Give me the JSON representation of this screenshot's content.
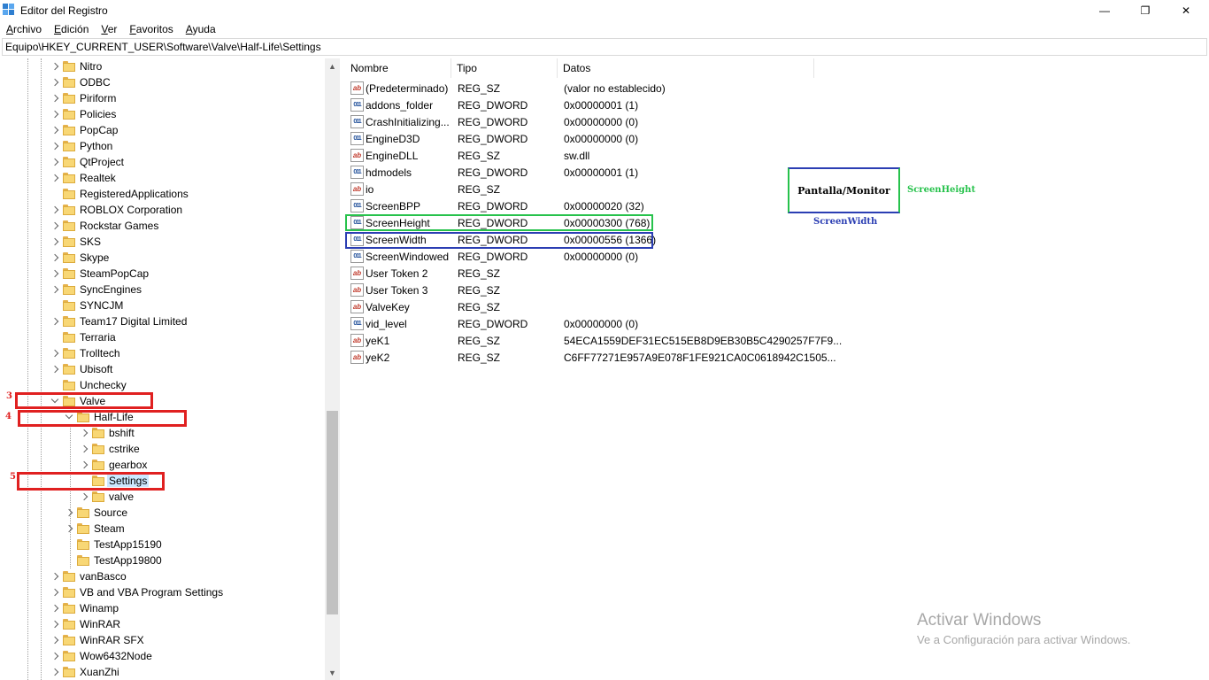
{
  "window": {
    "title": "Editor del Registro",
    "min_glyph": "—",
    "max_glyph": "❐",
    "close_glyph": "✕"
  },
  "menu": [
    {
      "u": "A",
      "rest": "rchivo"
    },
    {
      "u": "E",
      "rest": "dición"
    },
    {
      "u": "V",
      "rest": "er"
    },
    {
      "u": "F",
      "rest": "avoritos"
    },
    {
      "u": "A",
      "rest": "yuda"
    }
  ],
  "address": "Equipo\\HKEY_CURRENT_USER\\Software\\Valve\\Half-Life\\Settings",
  "tree": [
    {
      "label": "Nitro",
      "level": 0,
      "exp": "closed"
    },
    {
      "label": "ODBC",
      "level": 0,
      "exp": "closed"
    },
    {
      "label": "Piriform",
      "level": 0,
      "exp": "closed"
    },
    {
      "label": "Policies",
      "level": 0,
      "exp": "closed"
    },
    {
      "label": "PopCap",
      "level": 0,
      "exp": "closed"
    },
    {
      "label": "Python",
      "level": 0,
      "exp": "closed"
    },
    {
      "label": "QtProject",
      "level": 0,
      "exp": "closed"
    },
    {
      "label": "Realtek",
      "level": 0,
      "exp": "closed"
    },
    {
      "label": "RegisteredApplications",
      "level": 0,
      "exp": "none"
    },
    {
      "label": "ROBLOX Corporation",
      "level": 0,
      "exp": "closed"
    },
    {
      "label": "Rockstar Games",
      "level": 0,
      "exp": "closed"
    },
    {
      "label": "SKS",
      "level": 0,
      "exp": "closed"
    },
    {
      "label": "Skype",
      "level": 0,
      "exp": "closed"
    },
    {
      "label": "SteamPopCap",
      "level": 0,
      "exp": "closed"
    },
    {
      "label": "SyncEngines",
      "level": 0,
      "exp": "closed"
    },
    {
      "label": "SYNCJM",
      "level": 0,
      "exp": "none"
    },
    {
      "label": "Team17 Digital Limited",
      "level": 0,
      "exp": "closed"
    },
    {
      "label": "Terraria",
      "level": 0,
      "exp": "none"
    },
    {
      "label": "Trolltech",
      "level": 0,
      "exp": "closed"
    },
    {
      "label": "Ubisoft",
      "level": 0,
      "exp": "closed"
    },
    {
      "label": "Unchecky",
      "level": 0,
      "exp": "none"
    },
    {
      "label": "Valve",
      "level": 0,
      "exp": "open"
    },
    {
      "label": "Half-Life",
      "level": 1,
      "exp": "open"
    },
    {
      "label": "bshift",
      "level": 2,
      "exp": "closed"
    },
    {
      "label": "cstrike",
      "level": 2,
      "exp": "closed"
    },
    {
      "label": "gearbox",
      "level": 2,
      "exp": "closed"
    },
    {
      "label": "Settings",
      "level": 2,
      "exp": "none",
      "selected": true
    },
    {
      "label": "valve",
      "level": 2,
      "exp": "closed"
    },
    {
      "label": "Source",
      "level": 1,
      "exp": "closed"
    },
    {
      "label": "Steam",
      "level": 1,
      "exp": "closed"
    },
    {
      "label": "TestApp15190",
      "level": 1,
      "exp": "none"
    },
    {
      "label": "TestApp19800",
      "level": 1,
      "exp": "none"
    },
    {
      "label": "vanBasco",
      "level": 0,
      "exp": "closed"
    },
    {
      "label": "VB and VBA Program Settings",
      "level": 0,
      "exp": "closed"
    },
    {
      "label": "Winamp",
      "level": 0,
      "exp": "closed"
    },
    {
      "label": "WinRAR",
      "level": 0,
      "exp": "closed"
    },
    {
      "label": "WinRAR SFX",
      "level": 0,
      "exp": "closed"
    },
    {
      "label": "Wow6432Node",
      "level": 0,
      "exp": "closed"
    },
    {
      "label": "XuanZhi",
      "level": 0,
      "exp": "closed"
    }
  ],
  "columns": [
    "Nombre",
    "Tipo",
    "Datos"
  ],
  "values": [
    {
      "name": "(Predeterminado)",
      "type": "REG_SZ",
      "data": "(valor no establecido)",
      "icon": "sz"
    },
    {
      "name": "addons_folder",
      "type": "REG_DWORD",
      "data": "0x00000001 (1)",
      "icon": "dw"
    },
    {
      "name": "CrashInitializing...",
      "type": "REG_DWORD",
      "data": "0x00000000 (0)",
      "icon": "dw"
    },
    {
      "name": "EngineD3D",
      "type": "REG_DWORD",
      "data": "0x00000000 (0)",
      "icon": "dw"
    },
    {
      "name": "EngineDLL",
      "type": "REG_SZ",
      "data": "sw.dll",
      "icon": "sz"
    },
    {
      "name": "hdmodels",
      "type": "REG_DWORD",
      "data": "0x00000001 (1)",
      "icon": "dw"
    },
    {
      "name": "io",
      "type": "REG_SZ",
      "data": "",
      "icon": "sz"
    },
    {
      "name": "ScreenBPP",
      "type": "REG_DWORD",
      "data": "0x00000020 (32)",
      "icon": "dw"
    },
    {
      "name": "ScreenHeight",
      "type": "REG_DWORD",
      "data": "0x00000300 (768)",
      "icon": "dw"
    },
    {
      "name": "ScreenWidth",
      "type": "REG_DWORD",
      "data": "0x00000556 (1366)",
      "icon": "dw"
    },
    {
      "name": "ScreenWindowed",
      "type": "REG_DWORD",
      "data": "0x00000000 (0)",
      "icon": "dw"
    },
    {
      "name": "User Token 2",
      "type": "REG_SZ",
      "data": "",
      "icon": "sz"
    },
    {
      "name": "User Token 3",
      "type": "REG_SZ",
      "data": "",
      "icon": "sz"
    },
    {
      "name": "ValveKey",
      "type": "REG_SZ",
      "data": "",
      "icon": "sz"
    },
    {
      "name": "vid_level",
      "type": "REG_DWORD",
      "data": "0x00000000 (0)",
      "icon": "dw"
    },
    {
      "name": "yeK1",
      "type": "REG_SZ",
      "data": "54ECA1559DEF31EC515EB8D9EB30B5C4290257F7F9...",
      "icon": "sz"
    },
    {
      "name": "yeK2",
      "type": "REG_SZ",
      "data": "C6FF77271E957A9E078F1FE921CA0C0618942C1505...",
      "icon": "sz"
    }
  ],
  "annotations": {
    "step3": "3",
    "step4": "4",
    "step5": "5",
    "monitor_label": "Pantalla/Monitor",
    "height_label": "ScreenHeight",
    "width_label": "ScreenWidth",
    "red": "#e02020",
    "green": "#27c24c",
    "blue": "#2b3eb3"
  },
  "watermark": {
    "title": "Activar Windows",
    "subtitle": "Ve a Configuración para activar Windows."
  }
}
